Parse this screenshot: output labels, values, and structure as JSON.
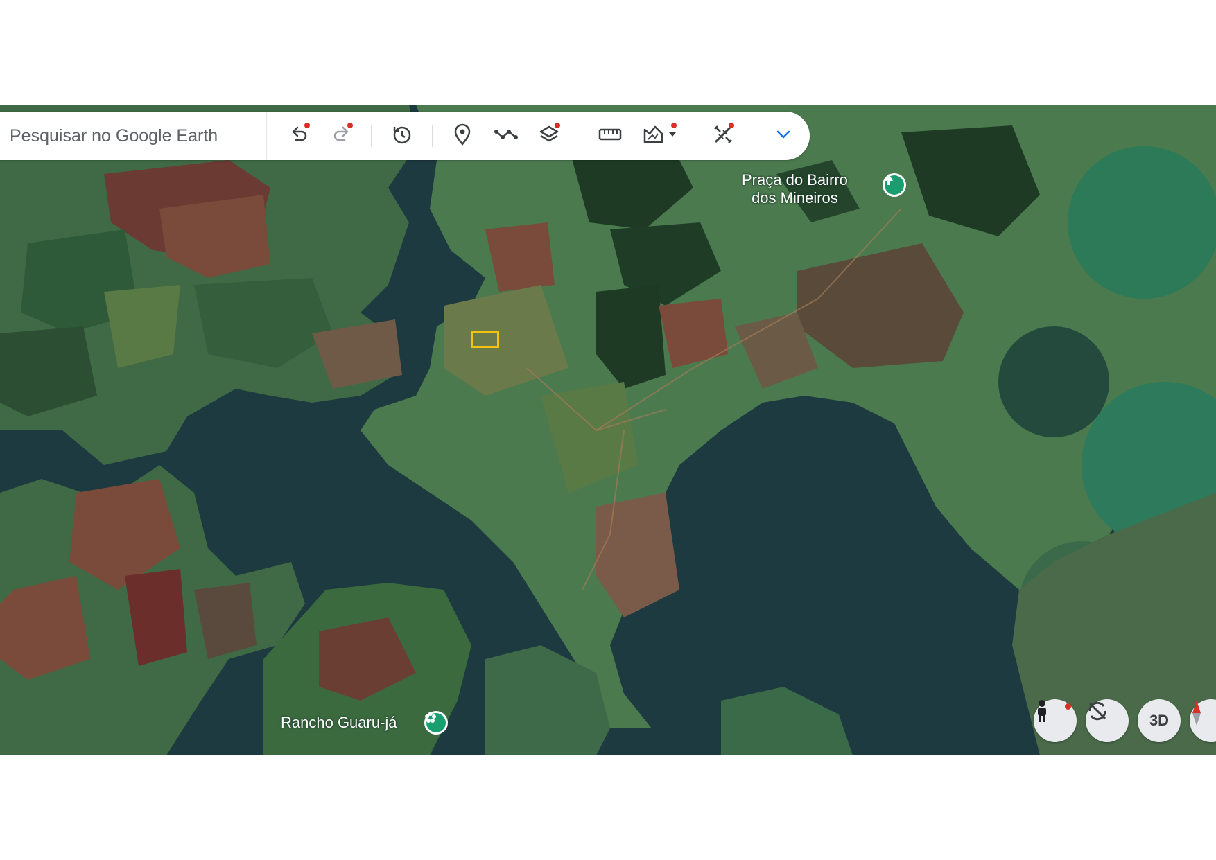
{
  "search": {
    "placeholder": "Pesquisar no Google Earth"
  },
  "toolbar": {
    "buttons": [
      {
        "name": "undo",
        "icon": "undo-icon",
        "badge": true
      },
      {
        "name": "redo",
        "icon": "redo-icon",
        "badge": true
      },
      {
        "name": "history",
        "icon": "history-icon",
        "badge": false
      },
      {
        "name": "add-placemark",
        "icon": "placemark-icon",
        "badge": false
      },
      {
        "name": "draw-path",
        "icon": "path-icon",
        "badge": false
      },
      {
        "name": "layers",
        "icon": "layers-icon",
        "badge": true
      },
      {
        "name": "measure",
        "icon": "ruler-icon",
        "badge": false
      },
      {
        "name": "terrain",
        "icon": "terrain-icon",
        "badge": true
      },
      {
        "name": "tools",
        "icon": "tools-icon",
        "badge": true
      },
      {
        "name": "more",
        "icon": "chevron-down-icon",
        "badge": false
      }
    ]
  },
  "places": [
    {
      "label": "Praça do Bairro\ndos Mineiros",
      "icon": "park-icon"
    },
    {
      "label": "Rancho Guaru-já",
      "icon": "flower-icon"
    }
  ],
  "controls": {
    "pegman": "pegman-icon",
    "rotate": "rotate-off-icon",
    "view3d_label": "3D",
    "compass": "compass-icon"
  },
  "colors": {
    "water": "#1c3a3f",
    "field_green": "#4a7a4e",
    "forest": "#1e3a24",
    "soil": "#7a4a3a",
    "circle_crop": "#2e7a5c",
    "badge": "#d93025",
    "place_pin": "#1a9e6f",
    "highlight": "#f4c20d"
  }
}
